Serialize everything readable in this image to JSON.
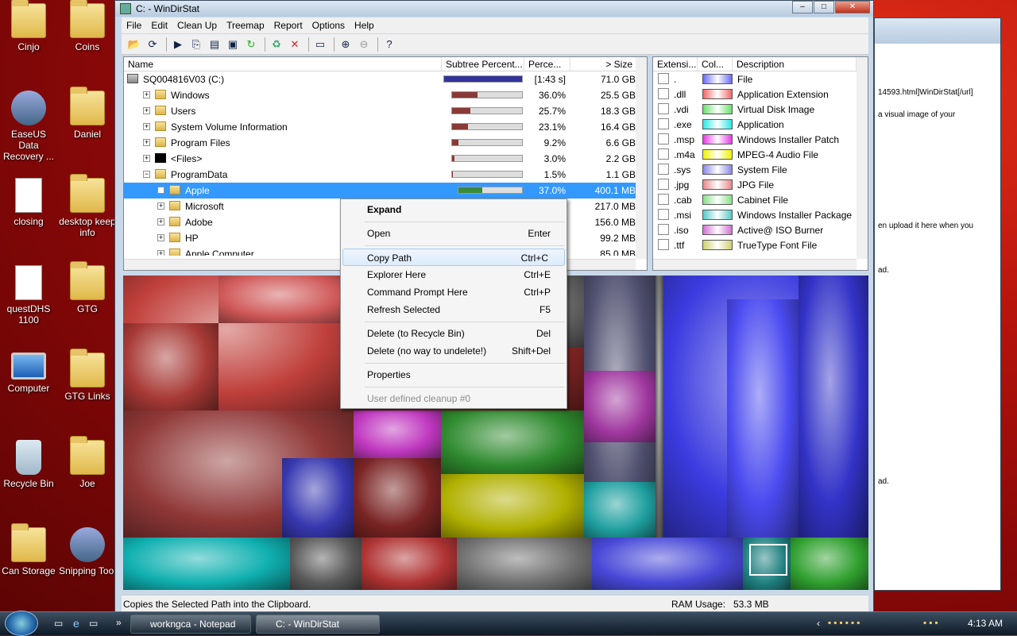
{
  "desktop": {
    "icons": [
      {
        "label": "Cinjo",
        "type": "folder"
      },
      {
        "label": "Coins",
        "type": "folder"
      },
      {
        "label": "EaseUS Data Recovery ...",
        "type": "app"
      },
      {
        "label": "Daniel",
        "type": "folder"
      },
      {
        "label": "closing",
        "type": "doc"
      },
      {
        "label": "desktop keep info",
        "type": "folder"
      },
      {
        "label": "questDHS 1100",
        "type": "doc"
      },
      {
        "label": "GTG",
        "type": "folder"
      },
      {
        "label": "Computer",
        "type": "computer"
      },
      {
        "label": "GTG Links",
        "type": "folder"
      },
      {
        "label": "Recycle Bin",
        "type": "bin"
      },
      {
        "label": "Joe",
        "type": "folder"
      },
      {
        "label": "Can Storage",
        "type": "folder"
      },
      {
        "label": "Snipping Tool",
        "type": "app"
      }
    ]
  },
  "window": {
    "title": "C: - WinDirStat"
  },
  "menu": [
    "File",
    "Edit",
    "Clean Up",
    "Treemap",
    "Report",
    "Options",
    "Help"
  ],
  "tree": {
    "columns": [
      "Name",
      "Subtree Percent...",
      "Perce...",
      "> Size"
    ],
    "rows": [
      {
        "name": "SQ004816V03 (C:)",
        "pct": "[1:43 s]",
        "size": "71.0 GB"
      },
      {
        "name": "Windows",
        "pct": "36.0%",
        "size": "25.5 GB"
      },
      {
        "name": "Users",
        "pct": "25.7%",
        "size": "18.3 GB"
      },
      {
        "name": "System Volume Information",
        "pct": "23.1%",
        "size": "16.4 GB"
      },
      {
        "name": "Program Files",
        "pct": "9.2%",
        "size": "6.6 GB"
      },
      {
        "name": "<Files>",
        "pct": "3.0%",
        "size": "2.2 GB"
      },
      {
        "name": "ProgramData",
        "pct": "1.5%",
        "size": "1.1 GB"
      },
      {
        "name": "Apple",
        "pct": "37.0%",
        "size": "400.1 MB"
      },
      {
        "name": "Microsoft",
        "pct": "",
        "size": "217.0 MB"
      },
      {
        "name": "Adobe",
        "pct": "",
        "size": "156.0 MB"
      },
      {
        "name": "HP",
        "pct": "",
        "size": "99.2 MB"
      },
      {
        "name": "Apple Computer",
        "pct": "",
        "size": "85.0 MB"
      }
    ]
  },
  "extensions": {
    "columns": [
      "Extensi...",
      "Col...",
      "Description"
    ],
    "rows": [
      {
        "ext": ".",
        "color": "#6b6bf5",
        "desc": "File"
      },
      {
        "ext": ".dll",
        "color": "#f06868",
        "desc": "Application Extension"
      },
      {
        "ext": ".vdi",
        "color": "#6ae06a",
        "desc": "Virtual Disk Image"
      },
      {
        "ext": ".exe",
        "color": "#2ae8e8",
        "desc": "Application"
      },
      {
        "ext": ".msp",
        "color": "#e838e8",
        "desc": "Windows Installer Patch"
      },
      {
        "ext": ".m4a",
        "color": "#f0f000",
        "desc": "MPEG-4 Audio File"
      },
      {
        "ext": ".sys",
        "color": "#8888e8",
        "desc": "System File"
      },
      {
        "ext": ".jpg",
        "color": "#e88888",
        "desc": "JPG File"
      },
      {
        "ext": ".cab",
        "color": "#88e088",
        "desc": "Cabinet File"
      },
      {
        "ext": ".msi",
        "color": "#58c8c8",
        "desc": "Windows Installer Package"
      },
      {
        "ext": ".iso",
        "color": "#d070d0",
        "desc": "Active@ ISO Burner"
      },
      {
        "ext": ".ttf",
        "color": "#d0d070",
        "desc": "TrueType Font File"
      }
    ]
  },
  "context_menu": {
    "items": [
      {
        "label": "Expand",
        "shortcut": "",
        "bold": true
      },
      {
        "label": "Open",
        "shortcut": "Enter"
      },
      {
        "label": "Copy Path",
        "shortcut": "Ctrl+C",
        "highlight": true
      },
      {
        "label": "Explorer Here",
        "shortcut": "Ctrl+E"
      },
      {
        "label": "Command Prompt Here",
        "shortcut": "Ctrl+P"
      },
      {
        "label": "Refresh Selected",
        "shortcut": "F5"
      },
      {
        "label": "Delete (to Recycle Bin)",
        "shortcut": "Del"
      },
      {
        "label": "Delete (no way to undelete!)",
        "shortcut": "Shift+Del"
      },
      {
        "label": "Properties",
        "shortcut": ""
      },
      {
        "label": "User defined cleanup #0",
        "shortcut": "",
        "disabled": true
      }
    ]
  },
  "status": {
    "message": "Copies the Selected Path into the Clipboard.",
    "ram_label": "RAM Usage:",
    "ram_value": "53.3 MB"
  },
  "bg_window": {
    "lines": [
      "14593.html]WinDirStat[/url]",
      "a visual image of your",
      "en upload it here when you",
      "ad.",
      "ad."
    ]
  },
  "taskbar": {
    "tasks": [
      "workngca - Notepad",
      "C: - WinDirStat"
    ],
    "clock": "4:13 AM"
  }
}
